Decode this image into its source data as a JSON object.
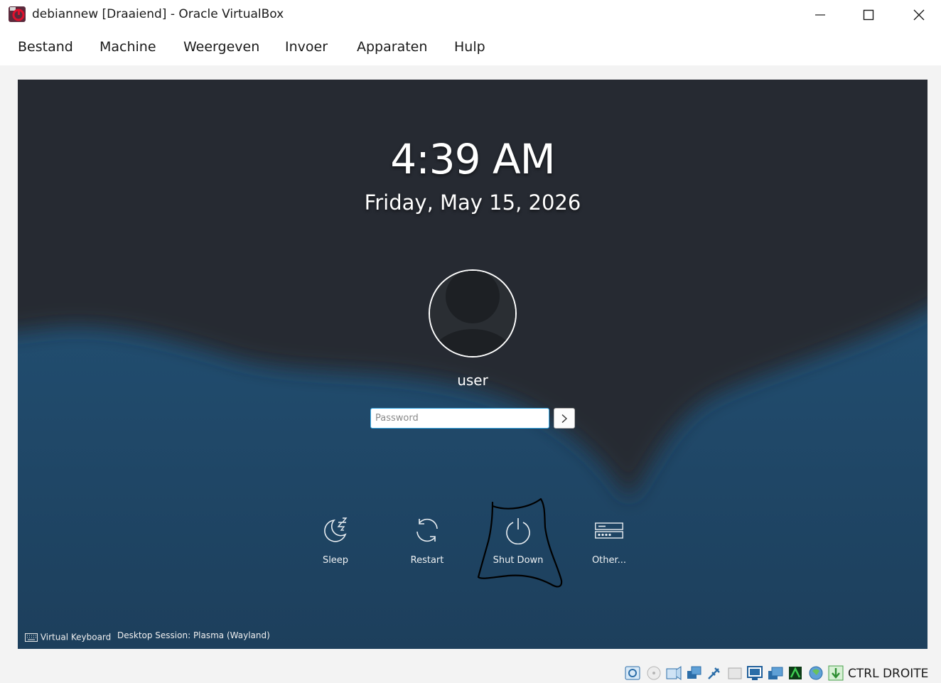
{
  "window": {
    "title": "debiannew [Draaiend] - Oracle VirtualBox"
  },
  "menu": {
    "items": [
      "Bestand",
      "Machine",
      "Weergeven",
      "Invoer",
      "Apparaten",
      "Hulp"
    ]
  },
  "lockscreen": {
    "time": "4:39 AM",
    "date": "Friday, May 15, 2026",
    "username": "user",
    "password_placeholder": "Password",
    "password_value": "",
    "actions": [
      {
        "label": "Sleep",
        "icon": "sleep-icon"
      },
      {
        "label": "Restart",
        "icon": "restart-icon"
      },
      {
        "label": "Shut Down",
        "icon": "power-icon"
      },
      {
        "label": "Other...",
        "icon": "other-icon"
      }
    ],
    "virtual_keyboard_label": "Virtual Keyboard",
    "session_label": "Desktop Session: Plasma (Wayland)"
  },
  "statusbar": {
    "icons": [
      "hard-disk-icon",
      "optical-drive-icon",
      "audio-icon",
      "network-icon",
      "usb-icon",
      "shared-folders-icon",
      "display-icon",
      "recording-icon",
      "cpu-icon",
      "mouse-integration-icon",
      "keyboard-capture-icon"
    ],
    "host_key": "CTRL DROITE"
  },
  "colors": {
    "accent": "#3daee9",
    "annotation_stroke": "#000000"
  }
}
